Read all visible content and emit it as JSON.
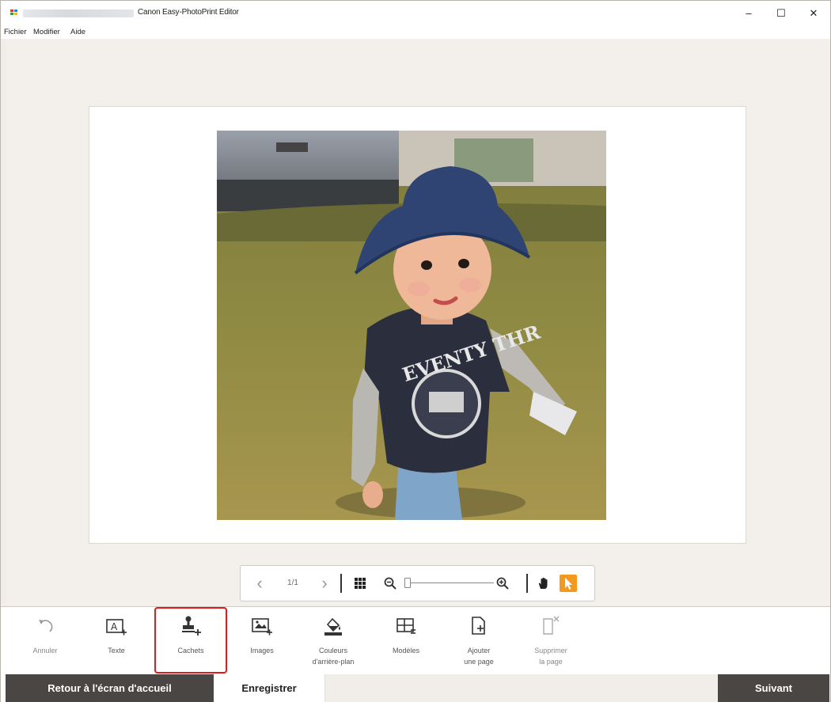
{
  "window": {
    "title": "Canon Easy-PhotoPrint Editor",
    "minimize": "–",
    "maximize": "☐",
    "close": "✕"
  },
  "menu": [
    "Fichier",
    "Modifier",
    "Aide"
  ],
  "page_nav": {
    "prev": "‹",
    "page_indicator": "1/1",
    "next": "›"
  },
  "tools": [
    {
      "label": "Annuler",
      "icon": "undo-icon",
      "enabled": false
    },
    {
      "label": "Texte",
      "icon": "text-add-icon",
      "enabled": true
    },
    {
      "label": "Cachets",
      "icon": "stamp-add-icon",
      "enabled": true,
      "highlighted": true
    },
    {
      "label": "Images",
      "icon": "image-add-icon",
      "enabled": true
    },
    {
      "label": "Couleurs\nd'arrière-plan",
      "icon": "paint-bucket-icon",
      "enabled": true
    },
    {
      "label": "Modèles",
      "icon": "layout-icon",
      "enabled": true
    },
    {
      "label": "Ajouter\nune page",
      "icon": "add-page-icon",
      "enabled": true
    },
    {
      "label": "Supprimer\nla page",
      "icon": "delete-page-icon",
      "enabled": false
    }
  ],
  "footer": {
    "home": "Retour à l'écran d'accueil",
    "save": "Enregistrer",
    "next": "Suivant"
  },
  "colors": {
    "dark_button": "#4a4644",
    "accent": "#f39a1e",
    "highlight": "#e4191b",
    "background": "#f1ede8"
  }
}
